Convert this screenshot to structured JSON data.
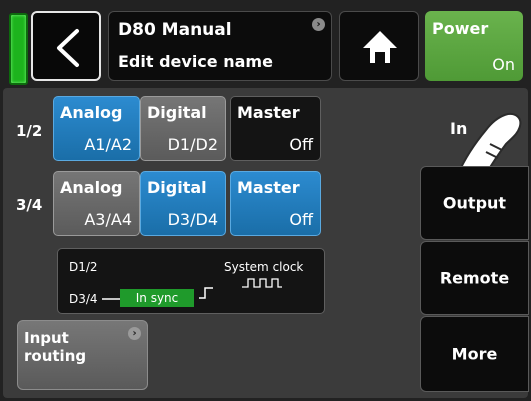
{
  "header": {
    "title": "D80 Manual",
    "subtitle": "Edit device name",
    "power_label": "Power",
    "power_state": "On"
  },
  "routing": {
    "rows": [
      {
        "label": "1/2",
        "analog": {
          "label": "Analog",
          "value": "A1/A2"
        },
        "digital": {
          "label": "Digital",
          "value": "D1/D2"
        },
        "master": {
          "label": "Master",
          "value": "Off"
        }
      },
      {
        "label": "3/4",
        "analog": {
          "label": "Analog",
          "value": "A3/A4"
        },
        "digital": {
          "label": "Digital",
          "value": "D3/D4"
        },
        "master": {
          "label": "Master",
          "value": "Off"
        }
      }
    ]
  },
  "sync": {
    "d12": "D1/2",
    "d34": "D3/4",
    "status": "In sync",
    "clock_label": "System clock"
  },
  "input_routing": {
    "line1": "Input",
    "line2": "routing"
  },
  "tabs": {
    "input": "In",
    "output": "Output",
    "remote": "Remote",
    "more": "More"
  },
  "colors": {
    "active_blue": "#1f7dbf",
    "inactive_gray": "#676767",
    "power_green": "#5ca840",
    "sync_green": "#1f9a2b",
    "led_green": "#1db31d"
  }
}
